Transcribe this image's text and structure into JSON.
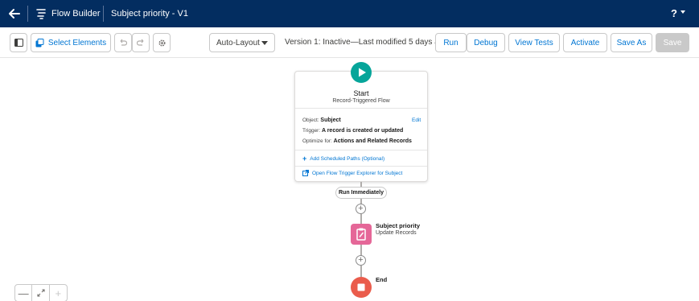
{
  "header": {
    "app_name": "Flow Builder",
    "flow_name": "Subject priority - V1",
    "help_label": "?",
    "bar_color": "#032d60"
  },
  "toolbar": {
    "toggle_panel_icon": "panel-toggle-icon",
    "select_elements_label": "Select Elements",
    "undo_icon": "undo-icon",
    "redo_icon": "redo-icon",
    "settings_icon": "gear-icon",
    "layout_select_value": "Auto-Layout",
    "version_text": "Version 1: Inactive—Last modified 5 days ago",
    "run_label": "Run",
    "debug_label": "Debug",
    "view_tests_label": "View Tests",
    "activate_label": "Activate",
    "save_as_label": "Save As",
    "save_label": "Save"
  },
  "canvas": {
    "start": {
      "title": "Start",
      "subtitle": "Record-Triggered Flow",
      "object_label": "Object:",
      "object_value": "Subject",
      "edit_label": "Edit",
      "trigger_label": "Trigger:",
      "trigger_value": "A record is created or updated",
      "optimize_label": "Optimize for:",
      "optimize_value": "Actions and Related Records",
      "add_paths_label": "Add Scheduled Paths (Optional)",
      "explorer_label": "Open Flow Trigger Explorer for Subject",
      "color": "#06a59a"
    },
    "path_label": "Run Immediately",
    "update_node": {
      "title": "Subject priority",
      "subtitle": "Update Records",
      "color": "#e56798"
    },
    "end_node": {
      "label": "End",
      "color": "#ea5c4c"
    }
  },
  "zoom_controls": {
    "zoom_out": "—",
    "fit": "fit-view-icon",
    "zoom_in": "+"
  }
}
